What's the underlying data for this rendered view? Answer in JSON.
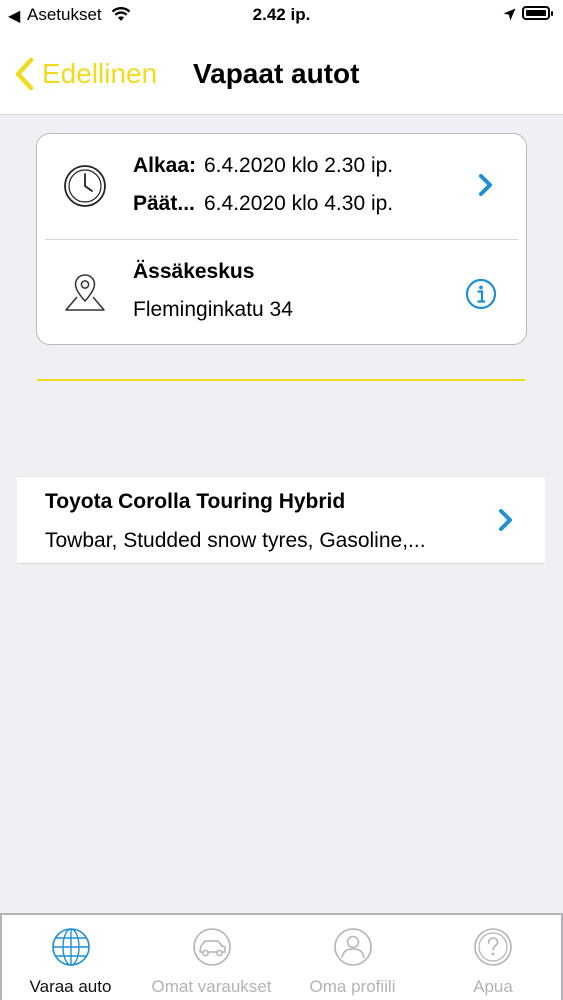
{
  "status_bar": {
    "back_glyph": "◀",
    "carrier": "Asetukset",
    "time": "2.42 ip."
  },
  "nav": {
    "back_label": "Edellinen",
    "title": "Vapaat autot"
  },
  "booking": {
    "start_label": "Alkaa:",
    "start_value": "6.4.2020 klo 2.30 ip.",
    "end_label": "Päät...",
    "end_value": "6.4.2020 klo 4.30 ip.",
    "location_name": "Ässäkeskus",
    "location_address": "Fleminginkatu 34"
  },
  "cars": [
    {
      "name": "Toyota Corolla Touring Hybrid",
      "features": "Towbar, Studded snow tyres, Gasoline,..."
    }
  ],
  "tabs": [
    {
      "label": "Varaa auto",
      "icon": "globe-icon",
      "active": true
    },
    {
      "label": "Omat varaukset",
      "icon": "car-icon",
      "active": false
    },
    {
      "label": "Oma profiili",
      "icon": "person-icon",
      "active": false
    },
    {
      "label": "Apua",
      "icon": "question-icon",
      "active": false
    }
  ],
  "colors": {
    "accent_yellow": "#f2db1c",
    "accent_blue": "#1e8fd4",
    "inactive_gray": "#b3b3b7",
    "background": "#efeff4"
  }
}
